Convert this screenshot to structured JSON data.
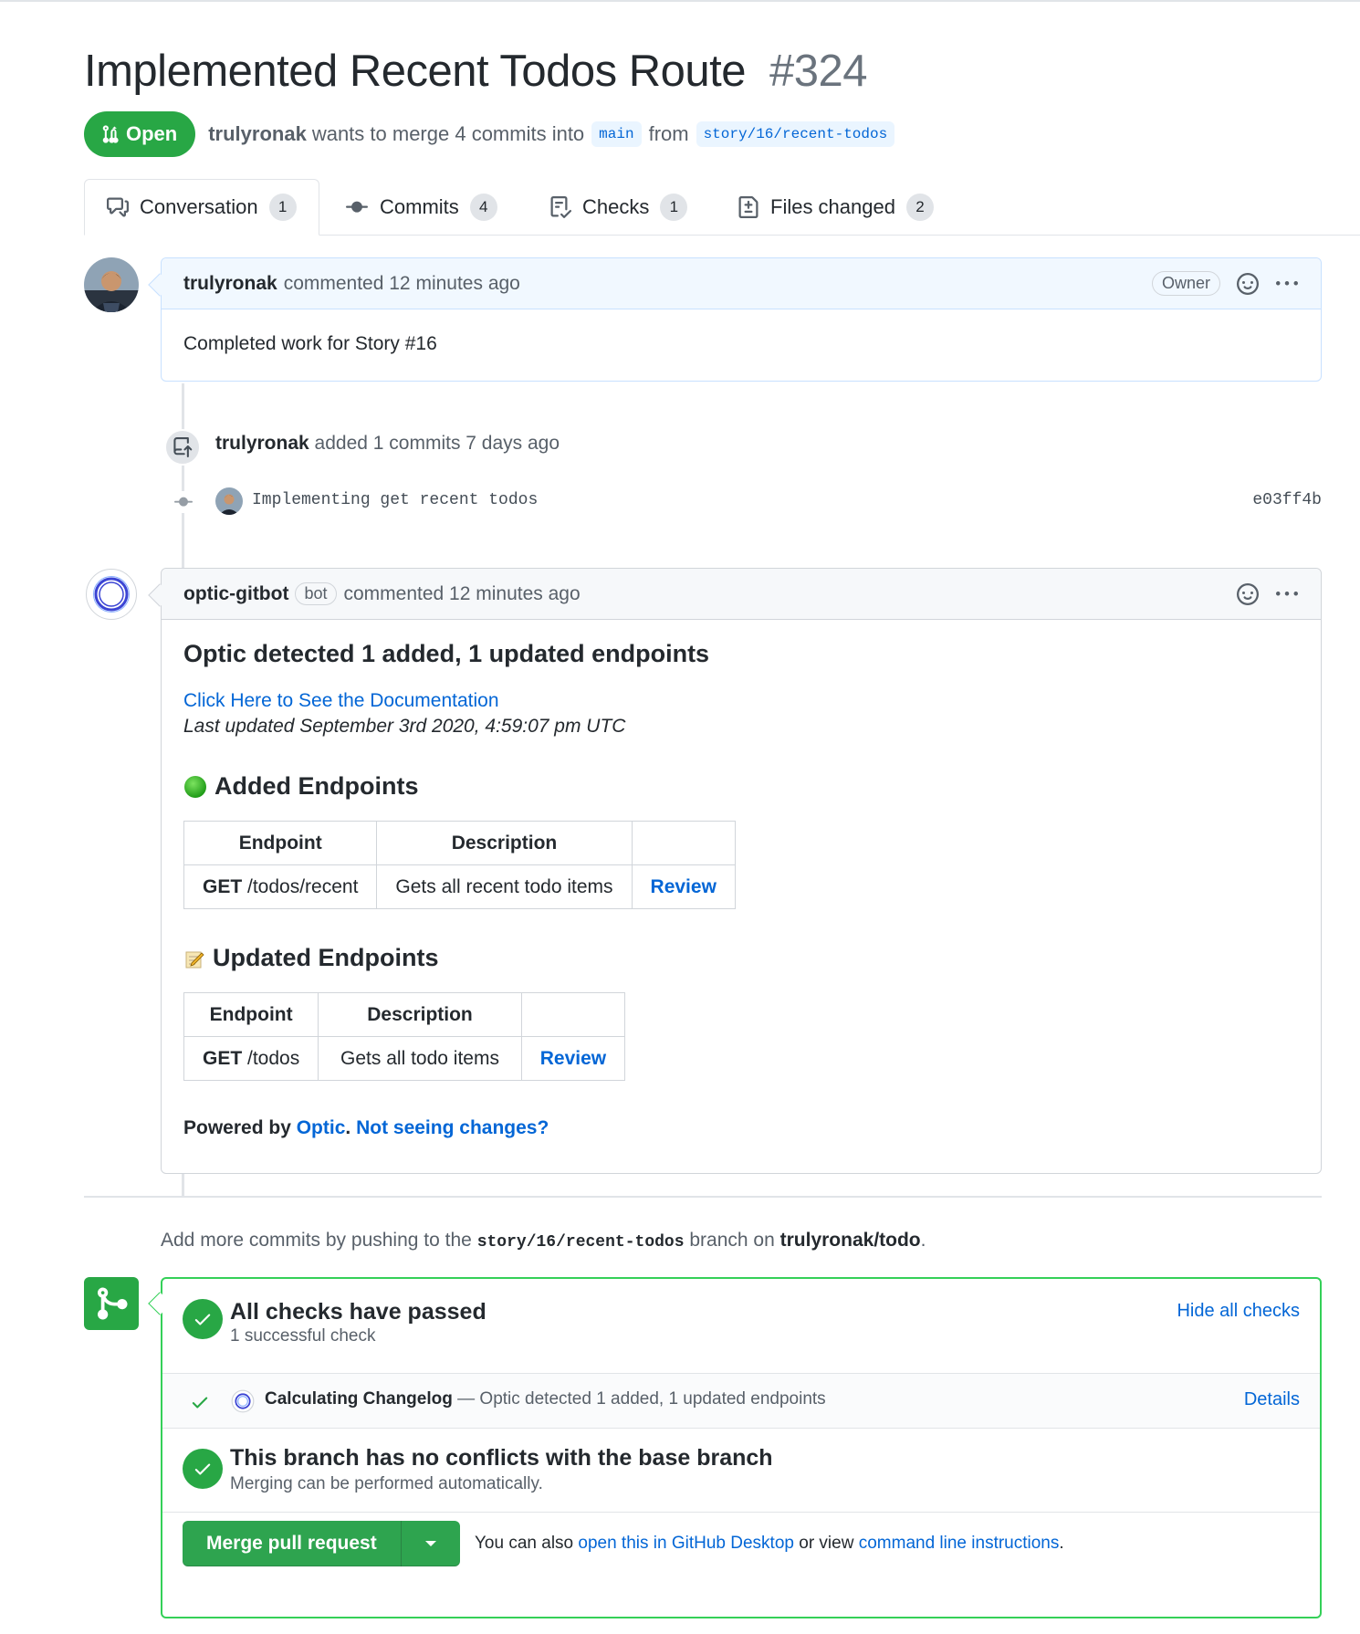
{
  "pr": {
    "title": "Implemented Recent Todos Route",
    "number": "#324",
    "state": "Open",
    "author": "trulyronak",
    "merge_text": "wants to merge 4 commits into",
    "base_branch": "main",
    "from_text": "from",
    "head_branch": "story/16/recent-todos"
  },
  "tabs": [
    {
      "label": "Conversation",
      "count": "1",
      "icon": "comment-discussion-icon"
    },
    {
      "label": "Commits",
      "count": "4",
      "icon": "git-commit-icon"
    },
    {
      "label": "Checks",
      "count": "1",
      "icon": "checklist-icon"
    },
    {
      "label": "Files changed",
      "count": "2",
      "icon": "file-diff-icon"
    }
  ],
  "comment1": {
    "author": "trulyronak",
    "action": "commented 12 minutes ago",
    "label": "Owner",
    "body": "Completed work for Story #16"
  },
  "commit_event": {
    "author": "trulyronak",
    "action": "added 1 commits 7 days ago",
    "commit_message": "Implementing get recent todos",
    "sha": "e03ff4b"
  },
  "comment2": {
    "author": "optic-gitbot",
    "label": "bot",
    "action": "commented 12 minutes ago",
    "heading": "Optic detected 1 added, 1 updated endpoints",
    "doc_link": "Click Here to See the Documentation",
    "last_updated": "Last updated September 3rd 2020, 4:59:07 pm UTC",
    "added_heading": "Added Endpoints",
    "updated_heading": "Updated Endpoints",
    "table_headers": {
      "endpoint": "Endpoint",
      "description": "Description"
    },
    "added_rows": [
      {
        "method": "GET",
        "path": "/todos/recent",
        "description": "Gets all recent todo items",
        "action": "Review"
      }
    ],
    "updated_rows": [
      {
        "method": "GET",
        "path": "/todos",
        "description": "Gets all todo items",
        "action": "Review"
      }
    ],
    "powered_by": "Powered by",
    "optic_link": "Optic",
    "period": ".",
    "not_seeing": "Not seeing changes?"
  },
  "push_hint": {
    "prefix": "Add more commits by pushing to the",
    "branch": "story/16/recent-todos",
    "middle": "branch on",
    "repo": "trulyronak/todo",
    "suffix": "."
  },
  "merge": {
    "checks_title": "All checks have passed",
    "checks_sub": "1 successful check",
    "hide_checks": "Hide all checks",
    "check_name": "Calculating Changelog",
    "check_desc": "— Optic detected 1 added, 1 updated endpoints",
    "details": "Details",
    "conflict_title": "This branch has no conflicts with the base branch",
    "conflict_sub": "Merging can be performed automatically.",
    "button": "Merge pull request",
    "also_prefix": "You can also",
    "desktop_link": "open this in GitHub Desktop",
    "or_view": "or view",
    "cli_link": "command line instructions",
    "also_suffix": "."
  },
  "colors": {
    "green": "#28a745",
    "link": "#0366d6",
    "border": "#d1d5da"
  }
}
